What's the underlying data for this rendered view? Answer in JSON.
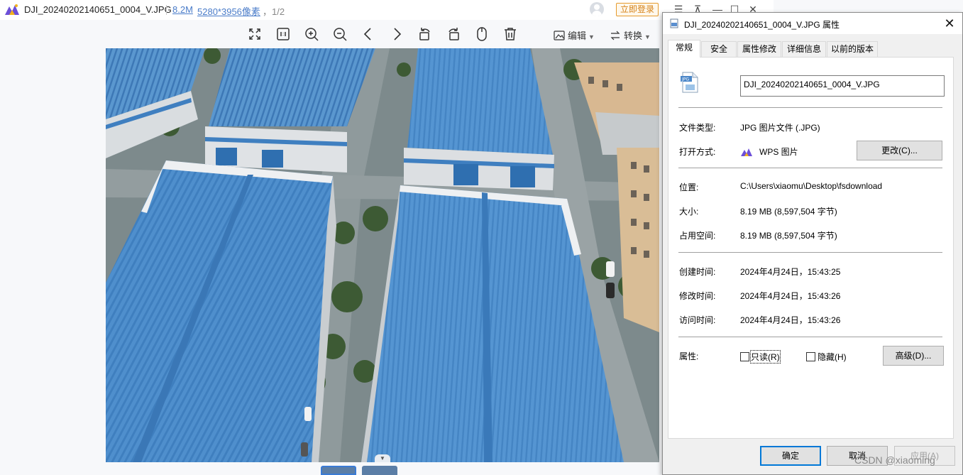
{
  "viewer": {
    "filename": "DJI_20240202140651_0004_V.JPG",
    "file_size": "8.2M",
    "dimensions": "5280*3956像素",
    "page_indicator": "，1/2",
    "login_label": "立即登录",
    "window_buttons": [
      "☰",
      "⊼",
      "—",
      "☐",
      "✕"
    ],
    "toolbar": {
      "edit_label": "编辑",
      "convert_label": "转换",
      "icons": [
        "fullscreen-icon",
        "actual-size-icon",
        "zoom-in-icon",
        "zoom-out-icon",
        "previous-icon",
        "next-icon",
        "rotate-left-icon",
        "rotate-right-icon",
        "mouse-icon",
        "delete-icon"
      ]
    },
    "image_subject": "aerial photo of blue factory rooftops"
  },
  "dialog": {
    "title": "DJI_20240202140651_0004_V.JPG 属性",
    "tabs": [
      {
        "label": "常规",
        "active": true
      },
      {
        "label": "安全",
        "active": false
      },
      {
        "label": "属性修改",
        "active": false
      },
      {
        "label": "详细信息",
        "active": false
      },
      {
        "label": "以前的版本",
        "active": false
      }
    ],
    "filename_value": "DJI_20240202140651_0004_V.JPG",
    "file_type": {
      "label": "文件类型:",
      "value": "JPG 图片文件 (.JPG)"
    },
    "open_with": {
      "label": "打开方式:",
      "value": "WPS 图片",
      "button": "更改(C)..."
    },
    "location": {
      "label": "位置:",
      "value": "C:\\Users\\xiaomu\\Desktop\\fsdownload"
    },
    "size": {
      "label": "大小:",
      "value": "8.19 MB (8,597,504 字节)"
    },
    "size_on_disk": {
      "label": "占用空间:",
      "value": "8.19 MB (8,597,504 字节)"
    },
    "created": {
      "label": "创建时间:",
      "value": "2024年4月24日，15:43:25"
    },
    "modified": {
      "label": "修改时间:",
      "value": "2024年4月24日，15:43:26"
    },
    "accessed": {
      "label": "访问时间:",
      "value": "2024年4月24日，15:43:26"
    },
    "attributes": {
      "label": "属性:",
      "readonly_label": "只读(R)",
      "readonly_checked": false,
      "hidden_label": "隐藏(H)",
      "hidden_checked": false,
      "advanced_button": "高级(D)..."
    },
    "footer": {
      "ok": "确定",
      "cancel": "取消",
      "apply": "应用(A)"
    }
  },
  "watermark": "CSDN @xiaoming",
  "colors": {
    "accent": "#0078d7",
    "login": "#e59a2c",
    "link": "#4a7cc9",
    "roof": "#4d8ecf"
  }
}
